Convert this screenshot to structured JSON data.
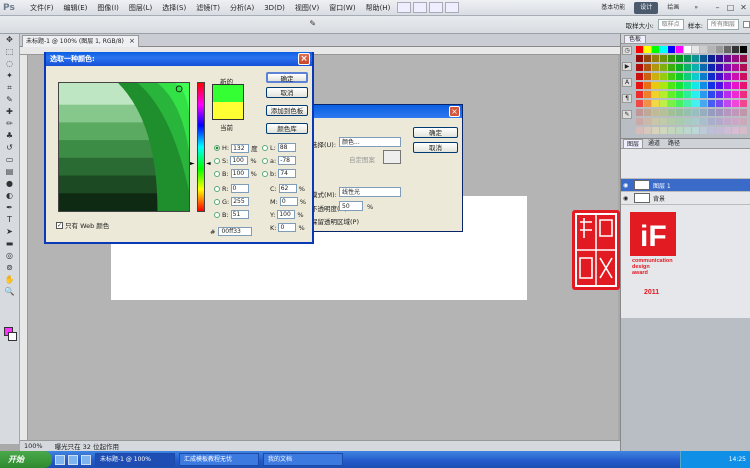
{
  "app": {
    "logo": "Ps",
    "menu": [
      "文件(F)",
      "编辑(E)",
      "图像(I)",
      "图层(L)",
      "选择(S)",
      "滤镜(T)",
      "分析(A)",
      "3D(D)",
      "视图(V)",
      "窗口(W)",
      "帮助(H)"
    ],
    "workspaces": [
      "基本功能",
      "设计",
      "绘画"
    ],
    "active_workspace": "设计"
  },
  "options_bar": {
    "feather_label": "取样大小:",
    "feather_value": "取样点",
    "sample_label": "样本:",
    "sample_value": "所有图层"
  },
  "document": {
    "tab": "未标题-1 @ 100% (图层 1, RGB/8)",
    "zoom": "100%",
    "status_text": "曝光只在 32 位起作用"
  },
  "panels": {
    "swatches_tab": "色板",
    "layers_tabs": [
      "图层",
      "通道",
      "路径"
    ],
    "layers": [
      {
        "name": "图层 1",
        "selected": true
      },
      {
        "name": "背景",
        "selected": false
      }
    ]
  },
  "award": {
    "lines": [
      "communication",
      "design",
      "award"
    ],
    "year": "2011",
    "logo_text": "iF"
  },
  "bg_dialog": {
    "row1_label": "选择(U):",
    "row1_value": "颜色...",
    "row2_label": "自定图案",
    "row3_label": "模式(M):",
    "row3_value": "线性光",
    "row4_label": "不透明度(O):",
    "row4_value": "50",
    "row4_unit": "%",
    "row5_label": "保留透明区域(P)",
    "ok": "确定",
    "cancel": "取消"
  },
  "color_picker": {
    "title": "选取一种颜色:",
    "new_label": "新的",
    "current_label": "当前",
    "buttons": {
      "ok": "确定",
      "cancel": "取消",
      "add_swatch": "添加到色板",
      "color_libraries": "颜色库"
    },
    "fields": {
      "H": {
        "label": "H:",
        "value": "132",
        "unit": "度"
      },
      "S": {
        "label": "S:",
        "value": "100",
        "unit": "%"
      },
      "B": {
        "label": "B:",
        "value": "100",
        "unit": "%"
      },
      "R": {
        "label": "R:",
        "value": "0",
        "unit": ""
      },
      "G": {
        "label": "G:",
        "value": "255",
        "unit": ""
      },
      "Bl": {
        "label": "B:",
        "value": "51",
        "unit": ""
      },
      "L": {
        "label": "L:",
        "value": "88",
        "unit": ""
      },
      "a": {
        "label": "a:",
        "value": "-78",
        "unit": ""
      },
      "b": {
        "label": "b:",
        "value": "74",
        "unit": ""
      },
      "C": {
        "label": "C:",
        "value": "62",
        "unit": "%"
      },
      "M": {
        "label": "M:",
        "value": "0",
        "unit": "%"
      },
      "Y": {
        "label": "Y:",
        "value": "100",
        "unit": "%"
      },
      "K": {
        "label": "K:",
        "value": "0",
        "unit": "%"
      }
    },
    "hex_label": "#",
    "hex_value": "00ff33",
    "web_only_label": "只有 Web 颜色",
    "web_only_checked": true,
    "new_color": "#33ff33",
    "current_color": "#ffff33"
  },
  "taskbar": {
    "start": "开始",
    "tasks": [
      "未标题-1 @ 100%",
      "汇成模板教程无忧",
      "我的文档"
    ],
    "clock": "14:25"
  }
}
